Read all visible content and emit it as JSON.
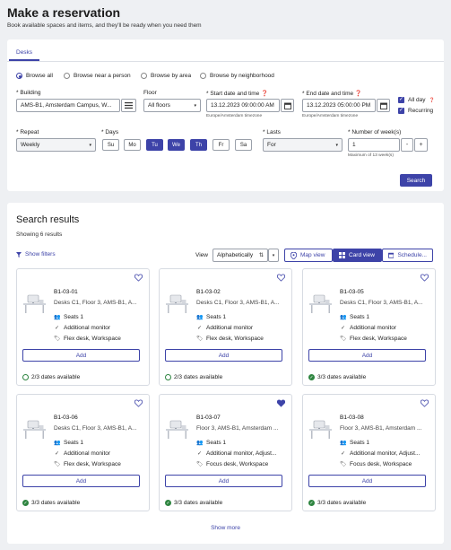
{
  "header": {
    "title": "Make a reservation",
    "subtitle": "Book available spaces and items, and they'll be ready when you need them"
  },
  "tabs": [
    {
      "label": "Desks",
      "active": true
    }
  ],
  "browse_options": [
    {
      "label": "Browse all",
      "selected": true
    },
    {
      "label": "Browse near a person",
      "selected": false
    },
    {
      "label": "Browse by area",
      "selected": false
    },
    {
      "label": "Browse by neighborhood",
      "selected": false
    }
  ],
  "form": {
    "building": {
      "label": "Building",
      "required_mark": "*",
      "value": "AMS-B1, Amsterdam Campus, W..."
    },
    "floor": {
      "label": "Floor",
      "value": "All floors"
    },
    "start": {
      "label": "Start date and time",
      "required_mark": "*",
      "value": "13.12.2023 09:00:00 AM",
      "hint": "Europe/Amsterdam timezone"
    },
    "end": {
      "label": "End date and time",
      "required_mark": "*",
      "value": "13.12.2023 05:00:00 PM",
      "hint": "Europe/Amsterdam timezone"
    },
    "all_day": {
      "label": "All day",
      "checked": true
    },
    "recurring": {
      "label": "Recurring",
      "checked": true
    },
    "repeat": {
      "label": "Repeat",
      "required_mark": "*",
      "value": "Weekly"
    },
    "days": {
      "label": "Days",
      "required_mark": "*",
      "items": [
        {
          "label": "Su",
          "on": false
        },
        {
          "label": "Mo",
          "on": false
        },
        {
          "label": "Tu",
          "on": true
        },
        {
          "label": "We",
          "on": true
        },
        {
          "label": "Th",
          "on": true
        },
        {
          "label": "Fr",
          "on": false
        },
        {
          "label": "Sa",
          "on": false
        }
      ]
    },
    "lasts": {
      "label": "Lasts",
      "required_mark": "*",
      "value": "For"
    },
    "weeks": {
      "label": "Number of week(s)",
      "required_mark": "*",
      "value": "1",
      "hint": "Maximum of 13 week(s)",
      "minus": "-",
      "plus": "+"
    },
    "search_label": "Search"
  },
  "results": {
    "title": "Search results",
    "count_text": "Showing 6 results",
    "show_filters": "Show filters",
    "view_label": "View",
    "sort_value": "Alphabetically",
    "map_view": "Map view",
    "card_view": "Card view",
    "schedule_view": "Schedule...",
    "add_label": "Add",
    "show_more": "Show more",
    "cards": [
      {
        "name": "B1-03-01",
        "location": "Desks C1, Floor 3, AMS-B1, A...",
        "seats": "Seats 1",
        "feature": "Additional monitor",
        "tags": "Flex desk, Workspace",
        "availability": "2/3 dates available",
        "full": false,
        "favorite": false
      },
      {
        "name": "B1-03-02",
        "location": "Desks C1, Floor 3, AMS-B1, A...",
        "seats": "Seats 1",
        "feature": "Additional monitor",
        "tags": "Flex desk, Workspace",
        "availability": "2/3 dates available",
        "full": false,
        "favorite": false
      },
      {
        "name": "B1-03-05",
        "location": "Desks C1, Floor 3, AMS-B1, A...",
        "seats": "Seats 1",
        "feature": "Additional monitor",
        "tags": "Flex desk, Workspace",
        "availability": "3/3 dates available",
        "full": true,
        "favorite": false
      },
      {
        "name": "B1-03-06",
        "location": "Desks C1, Floor 3, AMS-B1, A...",
        "seats": "Seats 1",
        "feature": "Additional monitor",
        "tags": "Flex desk, Workspace",
        "availability": "3/3 dates available",
        "full": true,
        "favorite": false
      },
      {
        "name": "B1-03-07",
        "location": "Floor 3, AMS-B1, Amsterdam ...",
        "seats": "Seats 1",
        "feature": "Additional monitor, Adjust...",
        "tags": "Focus desk, Workspace",
        "availability": "3/3 dates available",
        "full": true,
        "favorite": true
      },
      {
        "name": "B1-03-08",
        "location": "Floor 3, AMS-B1, Amsterdam ...",
        "seats": "Seats 1",
        "feature": "Additional monitor, Adjust...",
        "tags": "Focus desk, Workspace",
        "availability": "3/3 dates available",
        "full": true,
        "favorite": false
      }
    ]
  },
  "colors": {
    "accent": "#3d43a8",
    "success": "#2e8540",
    "background": "#eef0f3"
  }
}
